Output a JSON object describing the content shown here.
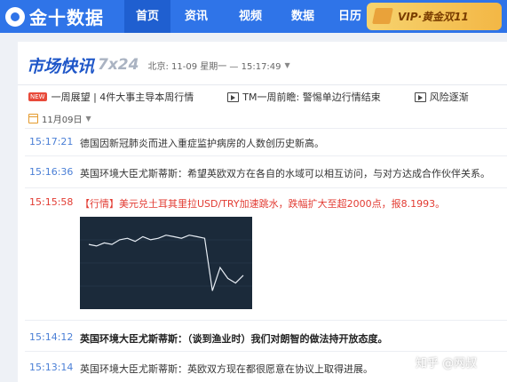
{
  "logo": {
    "text": "金十数据"
  },
  "nav": {
    "items": [
      "首页",
      "资讯",
      "视频",
      "数据",
      "日历"
    ]
  },
  "vip": {
    "text": "VIP·黄金双11"
  },
  "header": {
    "brand": "市场快讯",
    "brand_sub": "7x24",
    "location_time": "北京: 11-09 星期一 — 15:17:49"
  },
  "ticker": {
    "badge": "NEW",
    "items": [
      "一周展望 | 4件大事主导本周行情",
      "TM一周前瞻: 警惕单边行情结束",
      "风险逐渐"
    ]
  },
  "date": {
    "label": "11月09日"
  },
  "news": [
    {
      "time": "15:17:21",
      "text": "德国因新冠肺炎而进入重症监护病房的人数创历史新高。",
      "style": "normal"
    },
    {
      "time": "15:16:36",
      "text": "英国环境大臣尤斯蒂斯：希望英欧双方在各自的水域可以相互访问，与对方达成合作伙伴关系。",
      "style": "normal"
    },
    {
      "time": "15:15:58",
      "text": "【行情】美元兑土耳其里拉USD/TRY加速跳水，跌幅扩大至超2000点，报8.1993。",
      "style": "red"
    },
    {
      "time": "15:14:12",
      "text": "英国环境大臣尤斯蒂斯：（谈到渔业时）我们对朗智的做法持开放态度。",
      "style": "bold"
    },
    {
      "time": "15:13:14",
      "text": "英国环境大臣尤斯蒂斯：英欧双方现在都很愿意在协议上取得进展。",
      "style": "normal"
    }
  ],
  "chart_data": {
    "type": "line",
    "series": [
      {
        "values": [
          8.5,
          8.49,
          8.51,
          8.5,
          8.53,
          8.54,
          8.52,
          8.55,
          8.53,
          8.54,
          8.56,
          8.55,
          8.54,
          8.56,
          8.55,
          8.54,
          8.2,
          8.35,
          8.28,
          8.25,
          8.3
        ]
      }
    ]
  },
  "watermark": {
    "text": "知乎 @网叔"
  },
  "colors": {
    "accent": "#2f74e8",
    "time": "#4a7fd6",
    "red": "#e23b32"
  }
}
